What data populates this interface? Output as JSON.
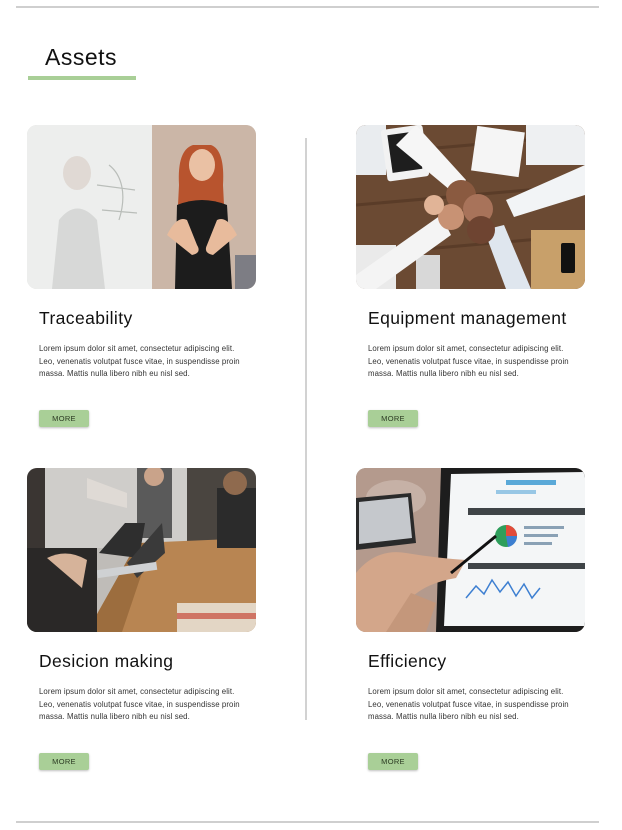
{
  "page": {
    "title": "Assets"
  },
  "cards": [
    {
      "title": "Traceability",
      "text": "Lorem ipsum dolor sit amet, consectetur adipiscing elit. Leo, venenatis volutpat fusce vitae, in suspendisse proin massa. Mattis nulla libero nibh eu nisl sed.",
      "button": "MORE",
      "image_icon": "woman-presenting-photo"
    },
    {
      "title": "Equipment management",
      "text": "Lorem ipsum dolor sit amet, consectetur adipiscing elit. Leo, venenatis volutpat fusce vitae, in suspendisse proin massa. Mattis nulla libero nibh eu nisl sed.",
      "button": "MORE",
      "image_icon": "team-fist-bump-photo"
    },
    {
      "title": "Desicion making",
      "text": "Lorem ipsum dolor sit amet, consectetur adipiscing elit. Leo, venenatis volutpat fusce vitae, in suspendisse proin massa. Mattis nulla libero nibh eu nisl sed.",
      "button": "MORE",
      "image_icon": "office-meeting-photo"
    },
    {
      "title": "Efficiency",
      "text": "Lorem ipsum dolor sit amet, consectetur adipiscing elit. Leo, venenatis volutpat fusce vitae, in suspendisse proin massa. Mattis nulla libero nibh eu nisl sed.",
      "button": "MORE",
      "image_icon": "tablet-analytics-photo"
    }
  ],
  "colors": {
    "accent": "#a9cf97",
    "rule": "#cfcfcf",
    "text": "#111111"
  }
}
